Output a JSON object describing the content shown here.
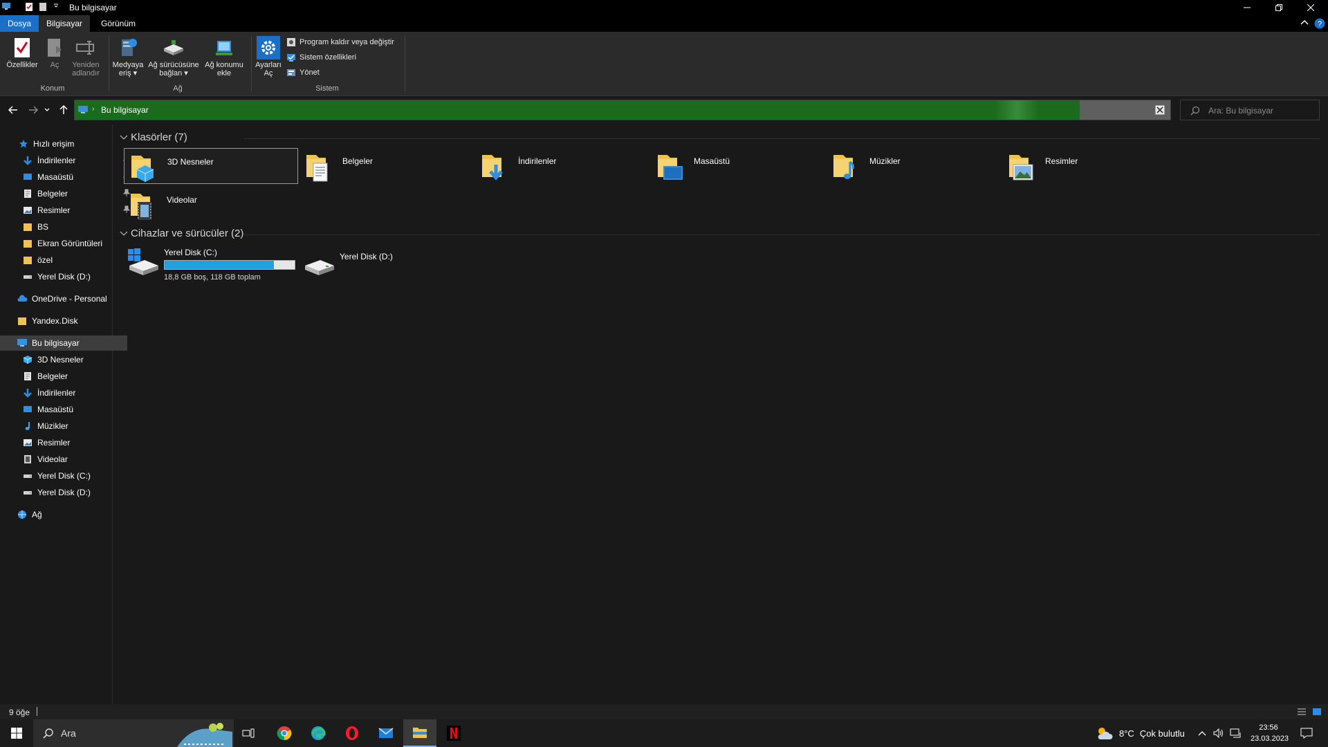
{
  "window": {
    "title": "Bu bilgisayar"
  },
  "ribbon": {
    "tabs": {
      "file": "Dosya",
      "computer": "Bilgisayar",
      "view": "Görünüm"
    },
    "location_group": {
      "label": "Konum",
      "properties": "Özellikler",
      "open": "Aç",
      "rename_line1": "Yeniden",
      "rename_line2": "adlandır"
    },
    "network_group": {
      "label": "Ağ",
      "media_line1": "Medyaya",
      "media_line2": "eriş",
      "map_drive_line1": "Ağ sürücüsüne",
      "map_drive_line2": "bağlan",
      "add_location_line1": "Ağ konumu",
      "add_location_line2": "ekle"
    },
    "system_group": {
      "label": "Sistem",
      "settings_line1": "Ayarları",
      "settings_line2": "Aç",
      "uninstall": "Program kaldır veya değiştir",
      "system_properties": "Sistem özellikleri",
      "manage": "Yönet"
    }
  },
  "address": {
    "location": "Bu bilgisayar",
    "search_placeholder": "Ara: Bu bilgisayar"
  },
  "nav": {
    "quick_access": "Hızlı erişim",
    "quick_items": [
      "İndirilenler",
      "Masaüstü",
      "Belgeler",
      "Resimler",
      "BS",
      "Ekran Görüntüleri",
      "özel",
      "Yerel Disk (D:)"
    ],
    "onedrive": "OneDrive - Personal",
    "yandex": "Yandex.Disk",
    "this_pc": "Bu bilgisayar",
    "pc_items": [
      "3D Nesneler",
      "Belgeler",
      "İndirilenler",
      "Masaüstü",
      "Müzikler",
      "Resimler",
      "Videolar",
      "Yerel Disk (C:)",
      "Yerel Disk (D:)"
    ],
    "network": "Ağ"
  },
  "content": {
    "folders_header": "Klasörler (7)",
    "folders": [
      "3D Nesneler",
      "Belgeler",
      "İndirilenler",
      "Masaüstü",
      "Müzikler",
      "Resimler",
      "Videolar"
    ],
    "drives_header": "Cihazlar ve sürücüler (2)",
    "drives": [
      {
        "name": "Yerel Disk (C:)",
        "free": "18,8 GB boş, 118 GB toplam",
        "used_fraction": 0.84
      },
      {
        "name": "Yerel Disk (D:)"
      }
    ]
  },
  "status": {
    "item_count": "9 öğe"
  },
  "taskbar": {
    "search_label": "Ara",
    "weather_temp": "8°C",
    "weather_text": "Çok bulutlu",
    "time": "23:56",
    "date": "23.03.2023"
  },
  "colors": {
    "accent": "#1a6fc9",
    "address_bg": "#1b6a1e",
    "drive_fill": "#26a0da",
    "window_bg": "#191919"
  }
}
